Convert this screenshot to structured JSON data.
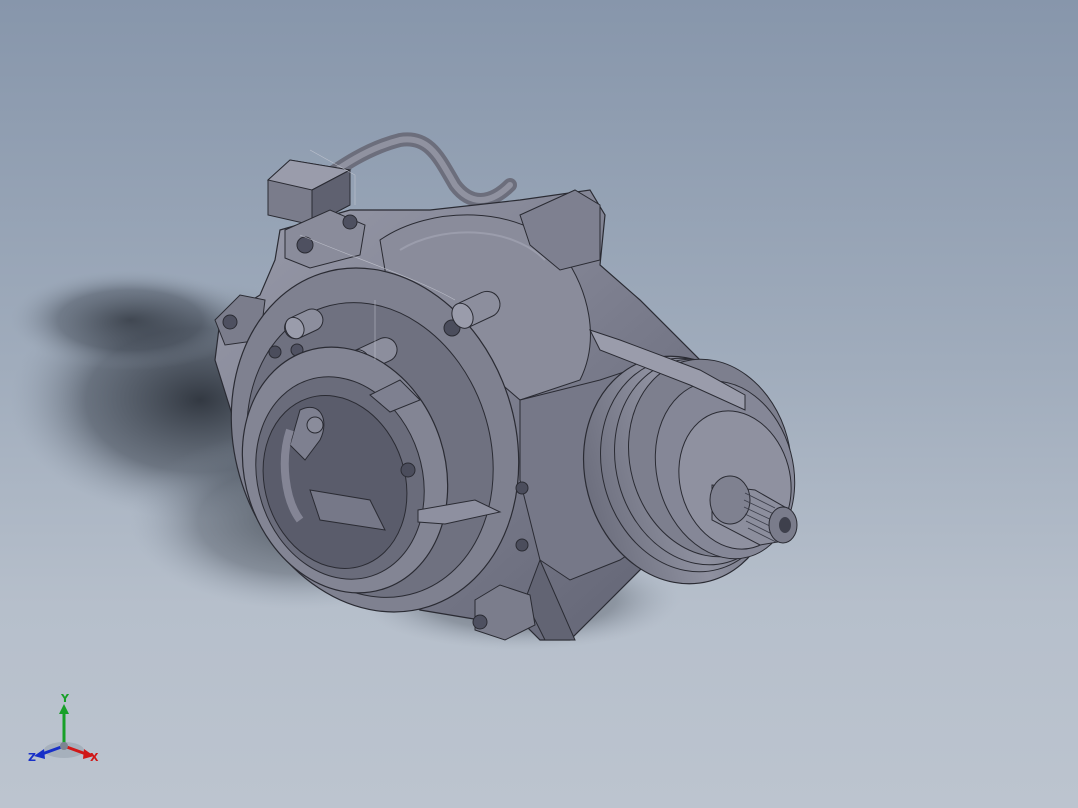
{
  "viewport": {
    "background_top": "#8796ab",
    "background_bottom": "#bcc4cf"
  },
  "model": {
    "name": "gearbox-assembly",
    "body_color": "#7a7c8c",
    "edge_color": "#2a2b33"
  },
  "triad": {
    "x_label": "X",
    "y_label": "Y",
    "z_label": "Z",
    "x_color": "#d01818",
    "y_color": "#18a028",
    "z_color": "#1830c8"
  }
}
